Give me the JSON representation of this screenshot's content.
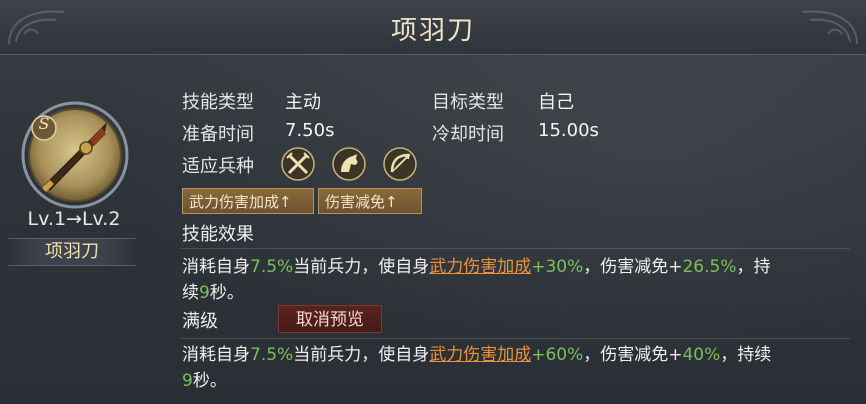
{
  "title": "项羽刀",
  "skill": {
    "grade": "S",
    "level_text": "Lv.1→Lv.2",
    "name": "项羽刀"
  },
  "info": {
    "type_label": "技能类型",
    "type_value": "主动",
    "target_label": "目标类型",
    "target_value": "自己",
    "prep_label": "准备时间",
    "prep_value": "7.50s",
    "cooldown_label": "冷却时间",
    "cooldown_value": "15.00s",
    "troops_label": "适应兵种",
    "troops": [
      "sword-icon",
      "horse-icon",
      "bow-icon"
    ]
  },
  "tags": [
    "武力伤害加成↑",
    "伤害减免↑"
  ],
  "effect": {
    "label": "技能效果",
    "line1_a": "消耗自身",
    "line1_pct": "7.5%",
    "line1_b": "当前兵力，使自身",
    "line1_link": "武力伤害加成",
    "line1_c": "+30%",
    "line1_d": "，伤害减免+",
    "line1_e": "26.5%",
    "line1_f": "，持",
    "line2_a": "续",
    "line2_num": "9",
    "line2_b": "秒。"
  },
  "max": {
    "label": "满级",
    "cancel_button": "取消预览",
    "line1_a": "消耗自身",
    "line1_pct": "7.5%",
    "line1_b": "当前兵力，使自身",
    "line1_link": "武力伤害加成",
    "line1_c": "+60%",
    "line1_d": "，伤害减免+",
    "line1_e": "40%",
    "line1_f": "，持续",
    "line2_num": "9",
    "line2_b": "秒。"
  },
  "colors": {
    "highlight_green": "#7ac057",
    "link_orange": "#e8923a",
    "title_gold": "#efe4c8"
  }
}
